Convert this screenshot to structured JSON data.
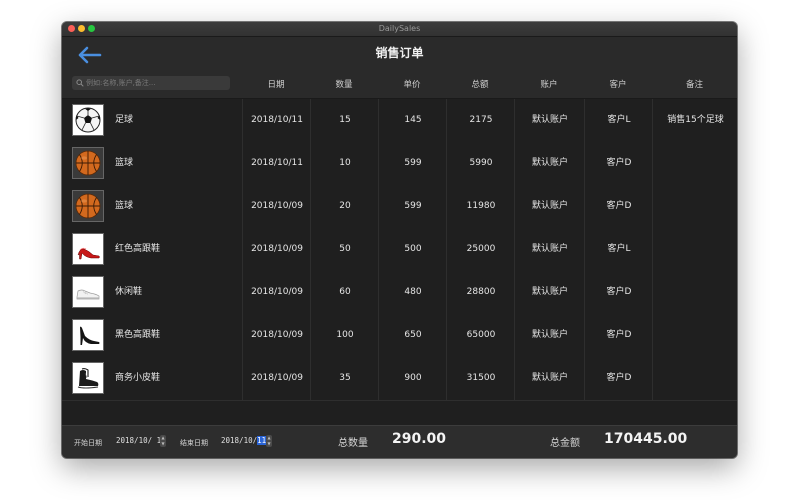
{
  "window": {
    "title": "DailySales"
  },
  "header": {
    "title": "销售订单"
  },
  "search": {
    "placeholder": "例如:名称,账户,备注..."
  },
  "columns": [
    "日期",
    "数量",
    "单价",
    "总额",
    "账户",
    "客户",
    "备注"
  ],
  "rows": [
    {
      "icon": "soccer-ball-icon",
      "name": "足球",
      "date": "2018/10/11",
      "qty": "15",
      "price": "145",
      "total": "2175",
      "account": "默认账户",
      "customer": "客户L",
      "note": "销售15个足球"
    },
    {
      "icon": "basketball-icon",
      "name": "篮球",
      "date": "2018/10/11",
      "qty": "10",
      "price": "599",
      "total": "5990",
      "account": "默认账户",
      "customer": "客户D",
      "note": ""
    },
    {
      "icon": "basketball-icon",
      "name": "篮球",
      "date": "2018/10/09",
      "qty": "20",
      "price": "599",
      "total": "11980",
      "account": "默认账户",
      "customer": "客户D",
      "note": ""
    },
    {
      "icon": "red-high-heel-icon",
      "name": "红色高跟鞋",
      "date": "2018/10/09",
      "qty": "50",
      "price": "500",
      "total": "25000",
      "account": "默认账户",
      "customer": "客户L",
      "note": ""
    },
    {
      "icon": "sneaker-icon",
      "name": "休闲鞋",
      "date": "2018/10/09",
      "qty": "60",
      "price": "480",
      "total": "28800",
      "account": "默认账户",
      "customer": "客户D",
      "note": ""
    },
    {
      "icon": "black-high-heel-icon",
      "name": "黑色高跟鞋",
      "date": "2018/10/09",
      "qty": "100",
      "price": "650",
      "total": "65000",
      "account": "默认账户",
      "customer": "客户D",
      "note": ""
    },
    {
      "icon": "leather-shoe-icon",
      "name": "商务小皮鞋",
      "date": "2018/10/09",
      "qty": "35",
      "price": "900",
      "total": "31500",
      "account": "默认账户",
      "customer": "客户D",
      "note": ""
    }
  ],
  "footer": {
    "start_label": "开始日期",
    "start_date_prefix": "2018/10/",
    "start_date_day": " 1",
    "end_label": "结束日期",
    "end_date_prefix": "2018/10/",
    "end_date_day": "11",
    "total_qty_label": "总数量",
    "total_qty_value": "290.00",
    "total_amount_label": "总金额",
    "total_amount_value": "170445.00"
  },
  "colors": {
    "accent": "#4a8fe0",
    "highlight": "#2a64d6",
    "background": "#262626"
  }
}
